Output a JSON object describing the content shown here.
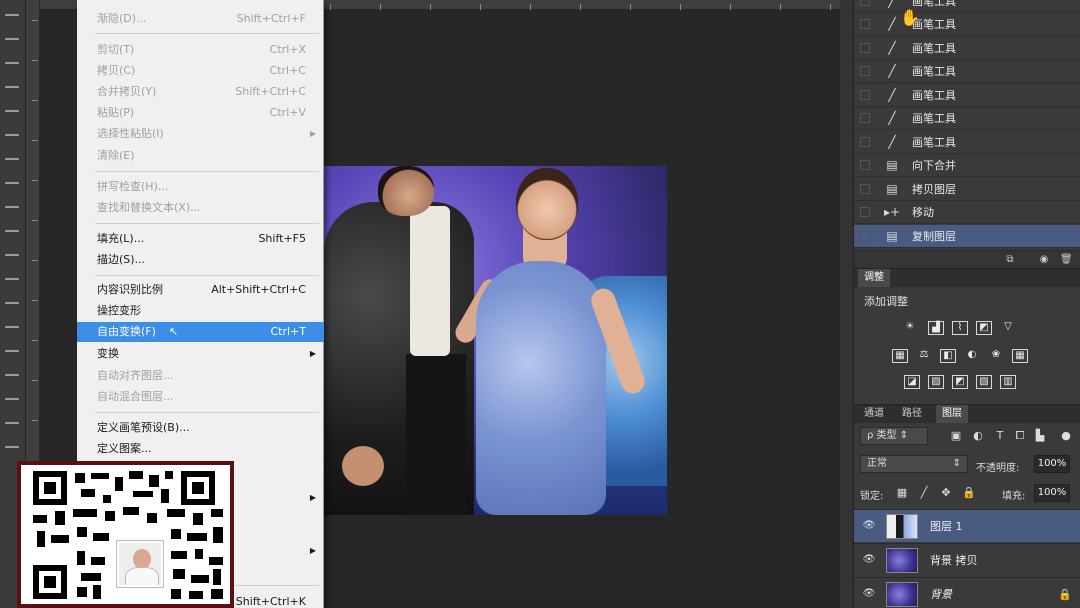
{
  "app": "Photoshop",
  "edit_menu": {
    "items": [
      {
        "label": "渐隐(D)...",
        "shortcut": "Shift+Ctrl+F",
        "disabled": true
      },
      {
        "label": "剪切(T)",
        "shortcut": "Ctrl+X",
        "disabled": true
      },
      {
        "label": "拷贝(C)",
        "shortcut": "Ctrl+C",
        "disabled": true
      },
      {
        "label": "合并拷贝(Y)",
        "shortcut": "Shift+Ctrl+C",
        "disabled": true
      },
      {
        "label": "粘贴(P)",
        "shortcut": "Ctrl+V",
        "disabled": true
      },
      {
        "label": "选择性粘贴(I)",
        "shortcut": "",
        "disabled": true,
        "submenu": true
      },
      {
        "label": "清除(E)",
        "shortcut": "",
        "disabled": true
      },
      {
        "label": "拼写检查(H)...",
        "shortcut": "",
        "disabled": true
      },
      {
        "label": "查找和替换文本(X)...",
        "shortcut": "",
        "disabled": true
      },
      {
        "label": "填充(L)...",
        "shortcut": "Shift+F5",
        "disabled": false
      },
      {
        "label": "描边(S)...",
        "shortcut": "",
        "disabled": false
      },
      {
        "label": "内容识别比例",
        "shortcut": "Alt+Shift+Ctrl+C",
        "disabled": false
      },
      {
        "label": "操控变形",
        "shortcut": "",
        "disabled": false
      },
      {
        "label": "自由变换(F)",
        "shortcut": "Ctrl+T",
        "disabled": false,
        "highlighted": true
      },
      {
        "label": "变换",
        "shortcut": "",
        "disabled": false,
        "submenu": true
      },
      {
        "label": "自动对齐图层...",
        "shortcut": "",
        "disabled": true
      },
      {
        "label": "自动混合图层...",
        "shortcut": "",
        "disabled": true
      },
      {
        "label": "定义画笔预设(B)...",
        "shortcut": "",
        "disabled": false
      },
      {
        "label": "定义图案...",
        "shortcut": "",
        "disabled": false
      }
    ],
    "bottom_shortcut": "Shift+Ctrl+K"
  },
  "history": {
    "items": [
      {
        "label": "画笔工具",
        "icon": "brush-icon"
      },
      {
        "label": "画笔工具",
        "icon": "brush-icon"
      },
      {
        "label": "画笔工具",
        "icon": "brush-icon"
      },
      {
        "label": "画笔工具",
        "icon": "brush-icon"
      },
      {
        "label": "画笔工具",
        "icon": "brush-icon"
      },
      {
        "label": "画笔工具",
        "icon": "brush-icon"
      },
      {
        "label": "向下合并",
        "icon": "document-icon"
      },
      {
        "label": "拷贝图层",
        "icon": "document-icon"
      },
      {
        "label": "移动",
        "icon": "move-icon"
      },
      {
        "label": "复制图层",
        "icon": "document-icon",
        "selected": true
      }
    ]
  },
  "adjustments": {
    "tab": "调整",
    "add_label": "添加调整"
  },
  "layers_panel": {
    "tabs": [
      "通道",
      "路径",
      "图层"
    ],
    "filter_label": "ρ 类型",
    "blend_mode": "正常",
    "opacity_label": "不透明度:",
    "opacity_value": "100%",
    "lock_label": "锁定:",
    "fill_label": "填充:",
    "fill_value": "100%",
    "layers": [
      {
        "name": "图层 1",
        "selected": true
      },
      {
        "name": "背景 拷贝",
        "selected": false
      },
      {
        "name": "背景",
        "selected": false,
        "locked": true
      }
    ]
  },
  "colors": {
    "menu_highlight": "#3c8ee6",
    "selection": "#4a5b82",
    "panel_bg": "#3a3a3a",
    "canvas_bg": "#272727"
  }
}
